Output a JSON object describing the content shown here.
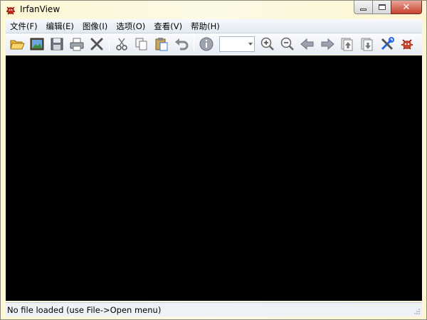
{
  "window": {
    "title": "IrfanView"
  },
  "menu": {
    "items": [
      {
        "label": "文件(F)"
      },
      {
        "label": "编辑(E)"
      },
      {
        "label": "图像(I)"
      },
      {
        "label": "选项(O)"
      },
      {
        "label": "查看(V)"
      },
      {
        "label": "帮助(H)"
      }
    ]
  },
  "toolbar": {
    "zoom_value": "",
    "buttons": [
      {
        "icon": "open-folder-icon"
      },
      {
        "icon": "slideshow-icon"
      },
      {
        "icon": "save-icon"
      },
      {
        "icon": "print-icon"
      },
      {
        "icon": "delete-icon"
      },
      {
        "icon": "cut-icon"
      },
      {
        "icon": "copy-icon"
      },
      {
        "icon": "paste-icon"
      },
      {
        "icon": "undo-icon"
      },
      {
        "icon": "info-icon"
      },
      {
        "icon": "zoom-in-icon"
      },
      {
        "icon": "zoom-out-icon"
      },
      {
        "icon": "previous-icon"
      },
      {
        "icon": "next-icon"
      },
      {
        "icon": "first-page-icon"
      },
      {
        "icon": "last-page-icon"
      },
      {
        "icon": "properties-tools-icon"
      },
      {
        "icon": "exit-irfanview-icon"
      }
    ]
  },
  "status": {
    "text": "No file loaded (use File->Open menu)"
  },
  "colors": {
    "canvas": "#000000",
    "accent_red": "#c7432f"
  }
}
